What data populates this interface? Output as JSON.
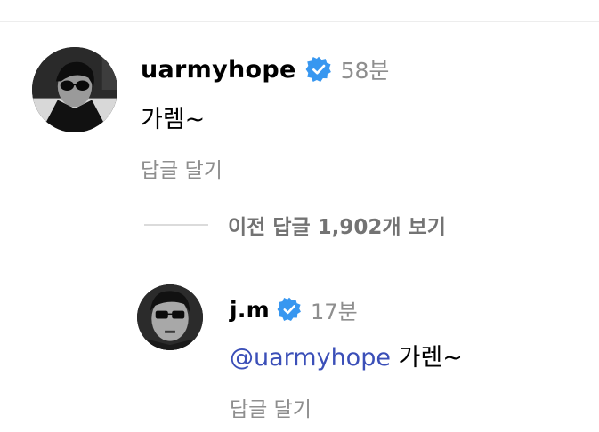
{
  "comments": [
    {
      "username": "uarmyhope",
      "verified": true,
      "time": "58분",
      "text": "가렘~",
      "reply_label": "답글 달기",
      "avatar_icon": "profile-photo"
    }
  ],
  "view_replies": {
    "label": "이전 답글 1,902개 보기"
  },
  "replies": [
    {
      "username": "j.m",
      "verified": true,
      "time": "17분",
      "mention": "@uarmyhope",
      "text": "가렌~",
      "reply_label": "답글 달기",
      "avatar_icon": "profile-photo"
    }
  ],
  "colors": {
    "verified_badge": "#3897f0",
    "mention": "#3b4fb8",
    "secondary_text": "#8e8e8e"
  }
}
